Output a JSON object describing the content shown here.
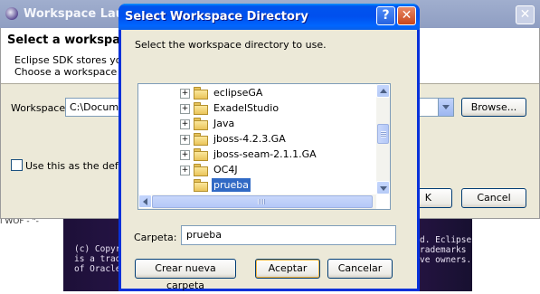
{
  "background": {
    "left_fragment": "l WOF - \"-",
    "splash_left": "(c) Copyri\nis a trader\nof Oracle",
    "splash_right": "d. Eclipse\nrademarks\nve owners."
  },
  "launcher": {
    "title": "Workspace Launch",
    "close_glyph": "✕",
    "header_title": "Select a workspace",
    "header_desc": "Eclipse SDK stores your\nChoose a workspace fol",
    "workspace_label": "Workspace:",
    "workspace_value": "C:\\Docume",
    "browse_label": "Browse...",
    "default_checkbox_label": "Use this as the defau",
    "ok_label": "K",
    "cancel_label": "Cancel"
  },
  "dialog": {
    "title": "Select Workspace Directory",
    "help_glyph": "?",
    "close_glyph": "✕",
    "message": "Select the workspace directory to use.",
    "tree": [
      {
        "label": "eclipseGA",
        "expander": "+",
        "selected": false
      },
      {
        "label": "ExadelStudio",
        "expander": "+",
        "selected": false
      },
      {
        "label": "Java",
        "expander": "+",
        "selected": false
      },
      {
        "label": "jboss-4.2.3.GA",
        "expander": "+",
        "selected": false
      },
      {
        "label": "jboss-seam-2.1.1.GA",
        "expander": "+",
        "selected": false
      },
      {
        "label": "OC4J",
        "expander": "+",
        "selected": false
      },
      {
        "label": "prueba",
        "expander": "",
        "selected": true
      }
    ],
    "folder_label": "Carpeta:",
    "folder_value": "prueba",
    "new_folder_label": "Crear nueva carpeta",
    "accept_label": "Aceptar",
    "cancel_label": "Cancelar"
  },
  "colors": {
    "title_bar": "#0054e3",
    "selection": "#316ac5",
    "dialog_bg": "#ece9d8"
  }
}
